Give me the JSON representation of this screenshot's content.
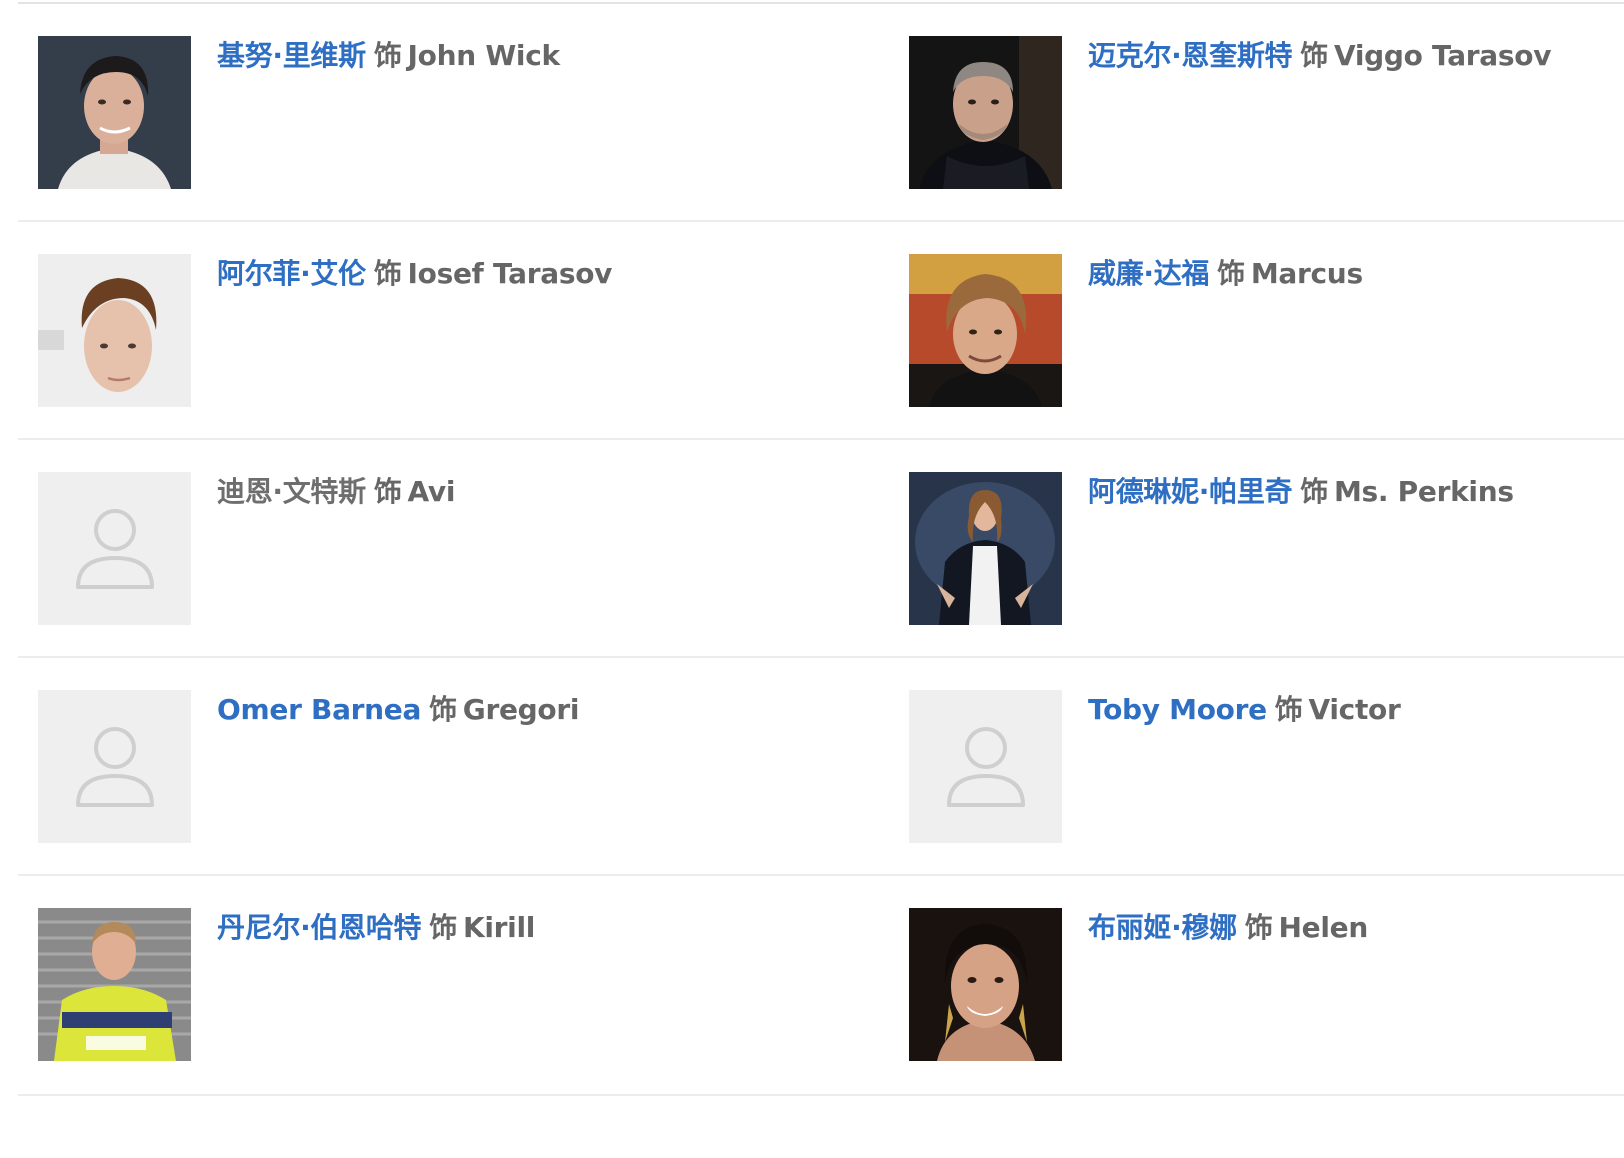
{
  "separator_word": "饰",
  "colors": {
    "link": "#2e6fc4",
    "text": "#666666",
    "divider": "#ececec",
    "placeholder_bg": "#efefef",
    "placeholder_icon": "#cfcfcf"
  },
  "cast": [
    {
      "actor": "基努·里维斯",
      "role": "John Wick",
      "linked": true,
      "photo": "keanu-photo"
    },
    {
      "actor": "迈克尔·恩奎斯特",
      "role": "Viggo Tarasov",
      "linked": true,
      "photo": "michael-photo"
    },
    {
      "actor": "阿尔菲·艾伦",
      "role": "Iosef Tarasov",
      "linked": true,
      "photo": "alfie-photo"
    },
    {
      "actor": "威廉·达福",
      "role": "Marcus",
      "linked": true,
      "photo": "willem-photo"
    },
    {
      "actor": "迪恩·文特斯",
      "role": "Avi",
      "linked": false,
      "photo": "person-placeholder-icon"
    },
    {
      "actor": "阿德琳妮·帕里奇",
      "role": "Ms. Perkins",
      "linked": true,
      "photo": "adrianne-photo"
    },
    {
      "actor": "Omer Barnea",
      "role": "Gregori",
      "linked": true,
      "photo": "person-placeholder-icon"
    },
    {
      "actor": "Toby Moore",
      "role": "Victor",
      "linked": true,
      "photo": "person-placeholder-icon"
    },
    {
      "actor": "丹尼尔·伯恩哈特",
      "role": "Kirill",
      "linked": true,
      "photo": "daniel-photo"
    },
    {
      "actor": "布丽姬·穆娜",
      "role": "Helen",
      "linked": true,
      "photo": "bridget-photo"
    }
  ]
}
